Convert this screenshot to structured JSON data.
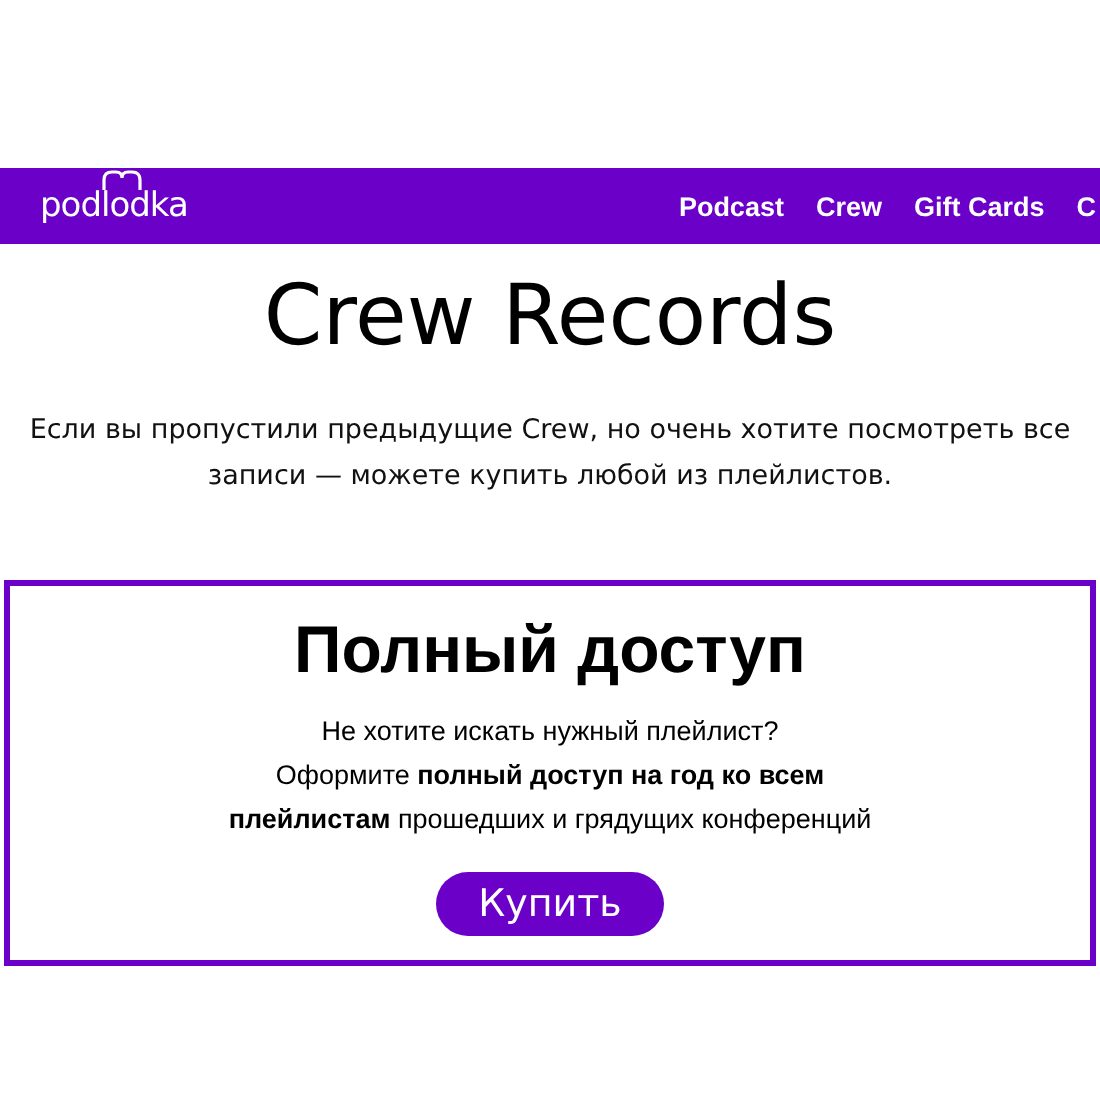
{
  "logo": "podlodka",
  "nav": [
    "Podcast",
    "Crew",
    "Gift Cards",
    "C"
  ],
  "title": "Crew Records",
  "intro": "Если вы пропустили предыдущие Crew, но очень хотите посмотреть все записи — можете купить любой из плейлистов.",
  "offer": {
    "title": "Полный доступ",
    "line1": "Не хотите искать нужный плейлист?",
    "line2": "Оформите **полный доступ на год ко всем плейлистам** прошедших и грядущих конференций",
    "button": "Купить"
  }
}
